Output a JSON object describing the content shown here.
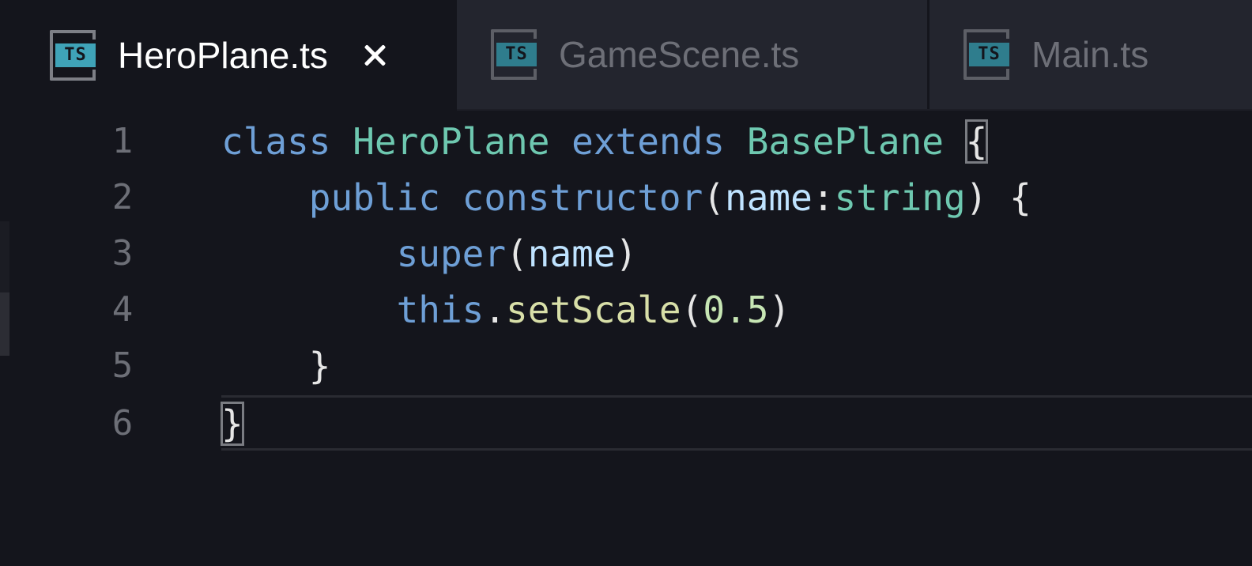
{
  "tabs": [
    {
      "label": "HeroPlane.ts",
      "icon": "typescript-file-icon",
      "icon_text": "TS",
      "active": true
    },
    {
      "label": "GameScene.ts",
      "icon": "typescript-file-icon",
      "icon_text": "TS",
      "active": false
    },
    {
      "label": "Main.ts",
      "icon": "typescript-file-icon",
      "icon_text": "TS",
      "active": false
    }
  ],
  "editor": {
    "lines": [
      {
        "number": "1",
        "tokens": [
          "class",
          "HeroPlane",
          "extends",
          "BasePlane",
          "{"
        ]
      },
      {
        "number": "2",
        "tokens": [
          "public",
          "constructor",
          "(",
          "name",
          ":",
          "string",
          ")",
          "{"
        ]
      },
      {
        "number": "3",
        "tokens": [
          "super",
          "(",
          "name",
          ")"
        ]
      },
      {
        "number": "4",
        "tokens": [
          "this",
          ".",
          "setScale",
          "(",
          "0.5",
          ")"
        ]
      },
      {
        "number": "5",
        "tokens": [
          "}"
        ]
      },
      {
        "number": "6",
        "tokens": [
          "}"
        ]
      }
    ],
    "current_line": 6
  },
  "colors": {
    "background": "#14151c",
    "keyword": "#6e9fd6",
    "type": "#6ec8b0",
    "function": "#d8dfa8",
    "number": "#c7e6b4",
    "ts_badge": "#3fa3b8"
  }
}
